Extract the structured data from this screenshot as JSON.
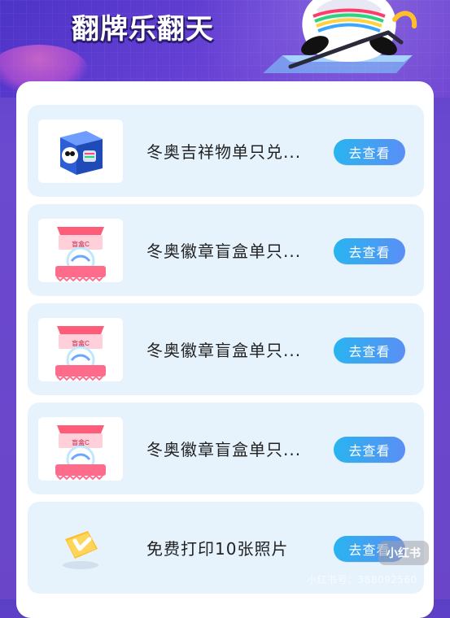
{
  "header": {
    "title": "翻牌乐翻天"
  },
  "items": [
    {
      "title": "冬奥吉祥物单只兑...",
      "button": "去查看",
      "thumb_icon": "mascot-box-icon"
    },
    {
      "title": "冬奥徽章盲盒单只...",
      "button": "去查看",
      "thumb_icon": "blind-box-icon"
    },
    {
      "title": "冬奥徽章盲盒单只...",
      "button": "去查看",
      "thumb_icon": "blind-box-icon"
    },
    {
      "title": "冬奥徽章盲盒单只...",
      "button": "去查看",
      "thumb_icon": "blind-box-icon"
    },
    {
      "title": "免费打印10张照片",
      "button": "去查看",
      "thumb_icon": "voucher-icon"
    }
  ],
  "blindbox_label": "盲盒C",
  "watermark": {
    "badge": "小红书",
    "id_text": "小红书号：388092560"
  },
  "colors": {
    "background": "#6a45c8",
    "row_background": "#e6f3fd",
    "button_start": "#29b4f0",
    "button_end": "#5a8ff5"
  }
}
